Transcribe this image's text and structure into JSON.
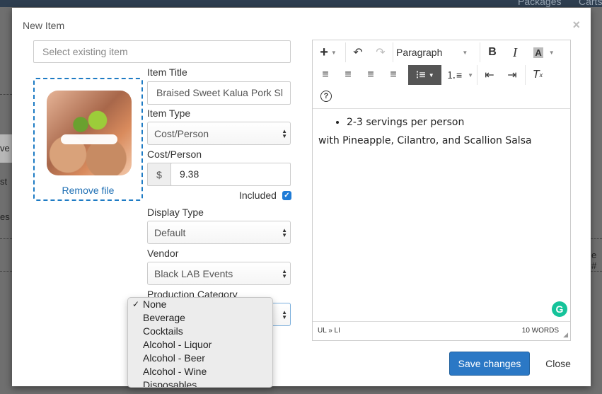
{
  "background": {
    "top_links": [
      "Packages",
      "Carts"
    ],
    "side_texts": [
      "ve",
      "st",
      "es"
    ],
    "right_text": "e #"
  },
  "modal": {
    "title": "New Item",
    "close_symbol": "×",
    "select_existing_placeholder": "Select existing item",
    "remove_file_label": "Remove file",
    "item_title_label": "Item Title",
    "item_title_value": "Braised Sweet Kalua Pork Sl",
    "item_type_label": "Item Type",
    "item_type_value": "Cost/Person",
    "cost_label": "Cost/Person",
    "cost_currency": "$",
    "cost_value": "9.38",
    "included_label": "Included",
    "included_checked": true,
    "display_type_label": "Display Type",
    "display_type_value": "Default",
    "vendor_label": "Vendor",
    "vendor_value": "Black LAB Events",
    "production_category_label": "Production Category",
    "production_category_options": [
      "None",
      "Beverage",
      "Cocktails",
      "Alcohol - Liquor",
      "Alcohol - Beer",
      "Alcohol - Wine",
      "Disposables"
    ],
    "production_category_selected": "None"
  },
  "editor": {
    "block_format": "Paragraph",
    "bullet_items": [
      "2-3 servings per person"
    ],
    "paragraph": "with Pineapple, Cilantro, and Scallion Salsa",
    "path": "UL » LI",
    "word_count": "10 WORDS"
  },
  "footer": {
    "save_label": "Save changes",
    "close_label": "Close"
  },
  "colors": {
    "primary": "#2b78c5",
    "dropzone_border": "#1e7bc4",
    "link": "#1e6fb4",
    "grammarly": "#15c39a"
  }
}
